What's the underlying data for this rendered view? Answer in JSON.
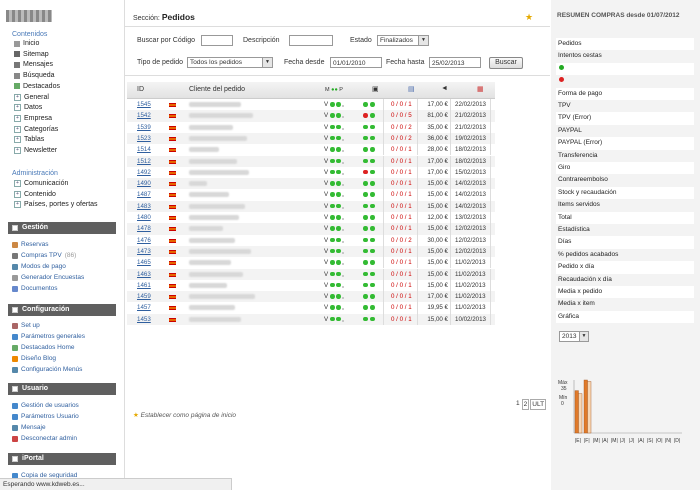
{
  "statusbar": "Esperando www.kdweb.es...",
  "sidebar": {
    "contenidos_title": "Contenidos",
    "contenidos": [
      "Inicio",
      "Sitemap",
      "Mensajes",
      "Búsqueda",
      "Destacados",
      "General",
      "Datos",
      "Empresa",
      "Categorías",
      "Tablas",
      "Newsletter"
    ],
    "admin_title": "Administración",
    "admin": [
      "Comunicación",
      "Contenido",
      "Países, portes y ofertas"
    ],
    "gestion_title": "Gestión",
    "gestion": [
      "Reservas",
      "Compras TPV",
      "Modos de pago",
      "Generador Encuestas",
      "Documentos"
    ],
    "compras_tpv_count": "(86)",
    "config_title": "Configuración",
    "config": [
      "Set up",
      "Parámetros generales",
      "Destacados Home",
      "Diseño Blog",
      "Configuración Menús"
    ],
    "usuario_title": "Usuario",
    "usuario": [
      "Gestión de usuarios",
      "Parámetros Usuario",
      "Mensaje",
      "Desconectar admin"
    ],
    "iportal_title": "iPortal",
    "iportal": [
      "Copia de seguridad"
    ]
  },
  "main": {
    "section_label": "Sección:",
    "section_name": "Pedidos",
    "filters": {
      "codigo_label": "Buscar por Código",
      "descripcion_label": "Descripción",
      "estado_label": "Estado",
      "estado_value": "Finalizados",
      "tipo_label": "Tipo de pedido",
      "tipo_value": "Todos los pedidos",
      "desde_label": "Fecha desde",
      "desde_value": "01/01/2010",
      "hasta_label": "Fecha hasta",
      "hasta_value": "25/02/2013",
      "buscar_label": "Buscar"
    },
    "table": {
      "col_id": "ID",
      "col_cliente": "Cliente del pedido",
      "col_status": "M",
      "rows": [
        {
          "id": "1545",
          "y": "V",
          "dots": [
            "g",
            "g"
          ],
          "ratio": "0 / 0 / 1",
          "amount": "17,00 €",
          "date": "22/02/2013",
          "nw": 52
        },
        {
          "id": "1542",
          "y": "V",
          "dots": [
            "r",
            "g"
          ],
          "ratio": "0 / 0 / 5",
          "amount": "81,00 €",
          "date": "21/02/2013",
          "nw": 64
        },
        {
          "id": "1539",
          "y": "V",
          "dots": [
            "g",
            "g"
          ],
          "ratio": "0 / 0 / 2",
          "amount": "35,00 €",
          "date": "21/02/2013",
          "nw": 44
        },
        {
          "id": "1523",
          "y": "V",
          "dots": [
            "g",
            "g"
          ],
          "ratio": "0 / 0 / 2",
          "amount": "36,00 €",
          "date": "19/02/2013",
          "nw": 58
        },
        {
          "id": "1514",
          "y": "V",
          "dots": [
            "g",
            "g"
          ],
          "ratio": "0 / 0 / 1",
          "amount": "28,00 €",
          "date": "18/02/2013",
          "nw": 30
        },
        {
          "id": "1512",
          "y": "V",
          "dots": [
            "g",
            "g"
          ],
          "ratio": "0 / 0 / 1",
          "amount": "17,00 €",
          "date": "18/02/2013",
          "nw": 48
        },
        {
          "id": "1492",
          "y": "V",
          "dots": [
            "r",
            "g"
          ],
          "ratio": "0 / 0 / 1",
          "amount": "17,00 €",
          "date": "15/02/2013",
          "nw": 60
        },
        {
          "id": "1490",
          "y": "V",
          "dots": [
            "g",
            "g"
          ],
          "ratio": "0 / 0 / 1",
          "amount": "15,00 €",
          "date": "14/02/2013",
          "nw": 18
        },
        {
          "id": "1487",
          "y": "V",
          "dots": [
            "g",
            "g"
          ],
          "ratio": "0 / 0 / 1",
          "amount": "15,00 €",
          "date": "14/02/2013",
          "nw": 40
        },
        {
          "id": "1483",
          "y": "V",
          "dots": [
            "g",
            "g"
          ],
          "ratio": "0 / 0 / 1",
          "amount": "15,00 €",
          "date": "14/02/2013",
          "nw": 56
        },
        {
          "id": "1480",
          "y": "V",
          "dots": [
            "g",
            "g"
          ],
          "ratio": "0 / 0 / 1",
          "amount": "12,00 €",
          "date": "13/02/2013",
          "nw": 50
        },
        {
          "id": "1478",
          "y": "V",
          "dots": [
            "g",
            "g"
          ],
          "ratio": "0 / 0 / 1",
          "amount": "15,00 €",
          "date": "12/02/2013",
          "nw": 34
        },
        {
          "id": "1476",
          "y": "V",
          "dots": [
            "g",
            "g"
          ],
          "ratio": "0 / 0 / 2",
          "amount": "30,00 €",
          "date": "12/02/2013",
          "nw": 46
        },
        {
          "id": "1473",
          "y": "V",
          "dots": [
            "g",
            "g"
          ],
          "ratio": "0 / 0 / 1",
          "amount": "15,00 €",
          "date": "12/02/2013",
          "nw": 62
        },
        {
          "id": "1465",
          "y": "V",
          "dots": [
            "g",
            "g"
          ],
          "ratio": "0 / 0 / 1",
          "amount": "15,00 €",
          "date": "11/02/2013",
          "nw": 42
        },
        {
          "id": "1463",
          "y": "V",
          "dots": [
            "g",
            "g"
          ],
          "ratio": "0 / 0 / 1",
          "amount": "15,00 €",
          "date": "11/02/2013",
          "nw": 54
        },
        {
          "id": "1461",
          "y": "V",
          "dots": [
            "g",
            "g"
          ],
          "ratio": "0 / 0 / 1",
          "amount": "15,00 €",
          "date": "11/02/2013",
          "nw": 38
        },
        {
          "id": "1459",
          "y": "V",
          "dots": [
            "g",
            "g"
          ],
          "ratio": "0 / 0 / 1",
          "amount": "17,00 €",
          "date": "11/02/2013",
          "nw": 66
        },
        {
          "id": "1457",
          "y": "V",
          "dots": [
            "g",
            "g"
          ],
          "ratio": "0 / 0 / 1",
          "amount": "19,95 €",
          "date": "11/02/2013",
          "nw": 46
        },
        {
          "id": "1453",
          "y": "V",
          "dots": [
            "g",
            "g"
          ],
          "ratio": "0 / 0 / 1",
          "amount": "15,00 €",
          "date": "10/02/2013",
          "nw": 52
        }
      ]
    },
    "pager": [
      "1",
      "2",
      "ULT"
    ],
    "home_link": "Establecer como página de inicio"
  },
  "right": {
    "title": "RESUMEN COMPRAS desde 01/07/2012",
    "rows": [
      {
        "label": "Pedidos",
        "h": true
      },
      {
        "label": "Intentos cestas",
        "h": false
      },
      {
        "label": "",
        "dot": "#2a2",
        "h": true
      },
      {
        "label": "",
        "dot": "#d22",
        "h": false
      },
      {
        "label": "Forma de pago",
        "h": true
      },
      {
        "label": "TPV",
        "h": false
      },
      {
        "label": "TPV (Error)",
        "h": true
      },
      {
        "label": "PAYPAL",
        "h": false
      },
      {
        "label": "PAYPAL (Error)",
        "h": true
      },
      {
        "label": "Transferencia",
        "h": false
      },
      {
        "label": "Giro",
        "h": true
      },
      {
        "label": "Contrareembolso",
        "h": false
      },
      {
        "label": "Stock y recaudación",
        "h": true
      },
      {
        "label": "Items servidos",
        "h": false
      },
      {
        "label": "Total",
        "h": true
      },
      {
        "label": "Estadística",
        "h": false
      },
      {
        "label": "Días",
        "h": true
      },
      {
        "label": "% pedidos acabados",
        "h": false
      },
      {
        "label": "Pedido x día",
        "h": true
      },
      {
        "label": "Recaudación x día",
        "h": false
      },
      {
        "label": "Media x pedido",
        "h": true
      },
      {
        "label": "Media x item",
        "h": false
      },
      {
        "label": "Gráfica",
        "h": true
      }
    ],
    "year": "2013"
  },
  "chart_data": {
    "type": "bar",
    "categories": [
      "E",
      "F",
      "M",
      "A",
      "M",
      "J",
      "J",
      "A",
      "S",
      "O",
      "N",
      "D"
    ],
    "series": [
      {
        "values": [
          28,
          35,
          0,
          0,
          0,
          0,
          0,
          0,
          0,
          0,
          0,
          0
        ]
      },
      {
        "values": [
          26,
          34,
          0,
          0,
          0,
          0,
          0,
          0,
          0,
          0,
          0,
          0
        ]
      }
    ],
    "max_label": "Máx",
    "max_value": "35",
    "min_label": "Mín",
    "min_value": "0",
    "colors": [
      "#e07a2a",
      "#f7d7b5"
    ]
  }
}
